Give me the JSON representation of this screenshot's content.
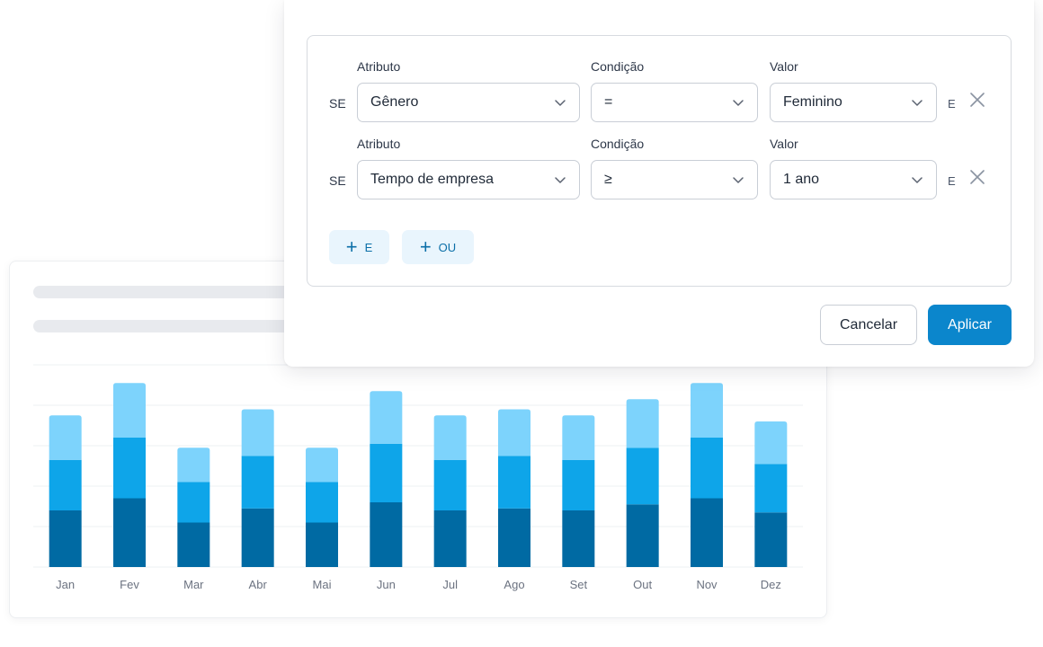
{
  "filter": {
    "rules": [
      {
        "prefix": "SE",
        "attribute_label": "Atributo",
        "condition_label": "Condição",
        "value_label": "Valor",
        "attribute": "Gênero",
        "condition": "=",
        "value": "Feminino",
        "connector": "E"
      },
      {
        "prefix": "SE",
        "attribute_label": "Atributo",
        "condition_label": "Condição",
        "value_label": "Valor",
        "attribute": "Tempo de empresa",
        "condition": "≥",
        "value": "1 ano",
        "connector": "E"
      }
    ],
    "add_and_label": "E",
    "add_or_label": "OU",
    "cancel_label": "Cancelar",
    "apply_label": "Aplicar"
  },
  "colors": {
    "accent": "#0b86cc",
    "series_dark": "#006aa3",
    "series_mid": "#0ea5e9",
    "series_light": "#7dd3fc"
  },
  "chart_data": {
    "type": "bar",
    "stacked": true,
    "categories": [
      "Jan",
      "Fev",
      "Mar",
      "Abr",
      "Mai",
      "Jun",
      "Jul",
      "Ago",
      "Set",
      "Out",
      "Nov",
      "Dez"
    ],
    "series": [
      {
        "color": "#006aa3",
        "values": [
          1.4,
          1.7,
          1.1,
          1.45,
          1.1,
          1.6,
          1.4,
          1.45,
          1.4,
          1.55,
          1.7,
          1.35
        ]
      },
      {
        "color": "#0ea5e9",
        "values": [
          1.25,
          1.5,
          1.0,
          1.3,
          1.0,
          1.45,
          1.25,
          1.3,
          1.25,
          1.4,
          1.5,
          1.2
        ]
      },
      {
        "color": "#7dd3fc",
        "values": [
          1.1,
          1.35,
          0.85,
          1.15,
          0.85,
          1.3,
          1.1,
          1.15,
          1.1,
          1.2,
          1.35,
          1.05
        ]
      }
    ],
    "ylim": [
      0,
      5
    ],
    "grid": true
  }
}
